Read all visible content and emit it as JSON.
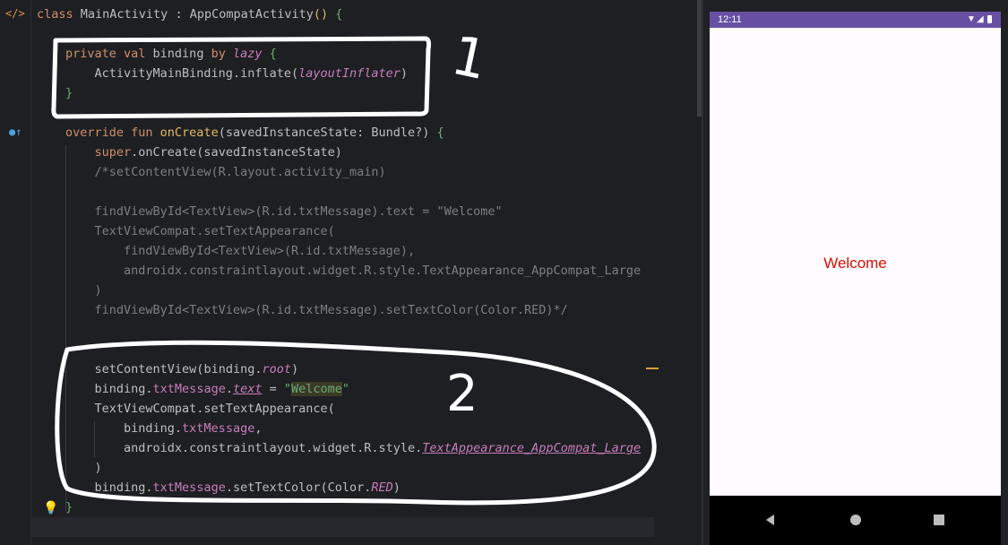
{
  "editor": {
    "lines": [
      {
        "id": "l1",
        "segs": [
          [
            "class ",
            "kw"
          ],
          [
            "MainActivity : ",
            "call"
          ],
          [
            "AppCompatActivity",
            "call"
          ],
          [
            "() ",
            "yellow"
          ],
          [
            "{",
            "brace-g"
          ]
        ]
      },
      {
        "id": "l3",
        "segs": [
          [
            "private val ",
            "kw"
          ],
          [
            "binding ",
            "call"
          ],
          [
            "by ",
            "kw"
          ],
          [
            "lazy ",
            "it2"
          ],
          [
            "{",
            "brace-g"
          ]
        ]
      },
      {
        "id": "l4",
        "segs": [
          [
            "    ActivityMainBinding.inflate(",
            "call"
          ],
          [
            "layoutInflater",
            "it"
          ],
          [
            ")",
            "call"
          ]
        ]
      },
      {
        "id": "l5",
        "segs": [
          [
            "}",
            "brace-g"
          ]
        ]
      },
      {
        "id": "l7",
        "segs": [
          [
            "override fun ",
            "kw"
          ],
          [
            "onCreate",
            "yellow"
          ],
          [
            "(savedInstanceState: Bundle?) ",
            "call"
          ],
          [
            "{",
            "brace-g"
          ]
        ]
      },
      {
        "id": "l8",
        "segs": [
          [
            "    ",
            "call"
          ],
          [
            "super",
            "kw"
          ],
          [
            ".onCreate(savedInstanceState)",
            "call"
          ]
        ]
      },
      {
        "id": "l9",
        "segs": [
          [
            "    /*setContentView(R.layout.activity_main)",
            "cm"
          ]
        ]
      },
      {
        "id": "l11",
        "segs": [
          [
            "    findViewById<TextView>(R.id.txtMessage).text = \"Welcome\"",
            "cm"
          ]
        ]
      },
      {
        "id": "l12",
        "segs": [
          [
            "    TextViewCompat.setTextAppearance(",
            "cm"
          ]
        ]
      },
      {
        "id": "l13",
        "segs": [
          [
            "        findViewById<TextView>(R.id.txtMessage),",
            "cm"
          ]
        ]
      },
      {
        "id": "l14",
        "segs": [
          [
            "        androidx.constraintlayout.widget.R.style.TextAppearance_AppCompat_Large",
            "cm"
          ]
        ]
      },
      {
        "id": "l15",
        "segs": [
          [
            "    )",
            "cm"
          ]
        ]
      },
      {
        "id": "l16",
        "segs": [
          [
            "    findViewById<TextView>(R.id.txtMessage).setTextColor(Color.RED)*/",
            "cm"
          ]
        ]
      },
      {
        "id": "l19",
        "segs": [
          [
            "    setContentView(",
            "call"
          ],
          [
            "binding.",
            "call"
          ],
          [
            "root",
            "it"
          ],
          [
            ")",
            "call"
          ]
        ]
      },
      {
        "id": "l20",
        "segs": [
          [
            "    binding.",
            "call"
          ],
          [
            "txtMessage",
            "purple"
          ],
          [
            ".",
            "call"
          ],
          [
            "text",
            "itul"
          ],
          [
            " = ",
            "call"
          ],
          [
            "\"",
            "str"
          ],
          [
            "Welcome",
            "strhl"
          ],
          [
            "\"",
            "str"
          ]
        ]
      },
      {
        "id": "l21",
        "segs": [
          [
            "    TextViewCompat.setTextAppearance(",
            "call"
          ]
        ]
      },
      {
        "id": "l22",
        "segs": [
          [
            "        binding.",
            "call"
          ],
          [
            "txtMessage",
            "purple"
          ],
          [
            ",",
            "call"
          ]
        ]
      },
      {
        "id": "l23",
        "segs": [
          [
            "        androidx.constraintlayout.widget.R.style.",
            "call"
          ],
          [
            "TextAppearance_AppCompat_Large",
            "itul"
          ]
        ]
      },
      {
        "id": "l24",
        "segs": [
          [
            "    )",
            "call"
          ]
        ]
      },
      {
        "id": "l25",
        "segs": [
          [
            "    binding.",
            "call"
          ],
          [
            "txtMessage",
            "purple"
          ],
          [
            ".setTextColor(Color.",
            "call"
          ],
          [
            "RED",
            "it"
          ],
          [
            ")",
            "call"
          ]
        ]
      },
      {
        "id": "l26",
        "segs": [
          [
            "}",
            "brace-g"
          ]
        ]
      },
      {
        "id": "l27",
        "segs": [
          [
            "}",
            "yellow"
          ]
        ]
      }
    ]
  },
  "annotations": {
    "label_1": "1",
    "label_2": "2"
  },
  "emulator": {
    "status_time": "12:11",
    "welcome_text": "Welcome",
    "status_color": "#6750a4",
    "text_color": "#d41000"
  }
}
